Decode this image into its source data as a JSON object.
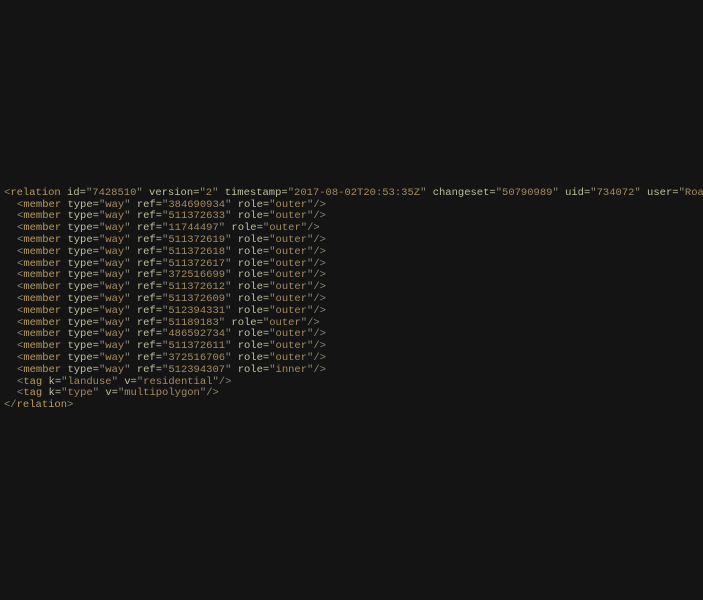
{
  "relation": {
    "id": "7428510",
    "version": "2",
    "timestamp": "2017-08-02T20:53:35Z",
    "changeset": "50790989",
    "uid": "734072",
    "user": "Roadsguy"
  },
  "members": [
    {
      "type": "way",
      "ref": "384690934",
      "role": "outer"
    },
    {
      "type": "way",
      "ref": "511372633",
      "role": "outer"
    },
    {
      "type": "way",
      "ref": "11744497",
      "role": "outer"
    },
    {
      "type": "way",
      "ref": "511372619",
      "role": "outer"
    },
    {
      "type": "way",
      "ref": "511372618",
      "role": "outer"
    },
    {
      "type": "way",
      "ref": "511372617",
      "role": "outer"
    },
    {
      "type": "way",
      "ref": "372516699",
      "role": "outer"
    },
    {
      "type": "way",
      "ref": "511372612",
      "role": "outer"
    },
    {
      "type": "way",
      "ref": "511372609",
      "role": "outer"
    },
    {
      "type": "way",
      "ref": "512394331",
      "role": "outer"
    },
    {
      "type": "way",
      "ref": "51189183",
      "role": "outer"
    },
    {
      "type": "way",
      "ref": "486592734",
      "role": "outer"
    },
    {
      "type": "way",
      "ref": "511372611",
      "role": "outer"
    },
    {
      "type": "way",
      "ref": "372516706",
      "role": "outer"
    },
    {
      "type": "way",
      "ref": "512394307",
      "role": "inner"
    }
  ],
  "tags": [
    {
      "k": "landuse",
      "v": "residential"
    },
    {
      "k": "type",
      "v": "multipolygon"
    }
  ],
  "labels": {
    "relation": "relation",
    "member": "member",
    "tag": "tag",
    "id": "id",
    "version": "version",
    "timestamp": "timestamp",
    "changeset": "changeset",
    "uid": "uid",
    "user": "user",
    "type": "type",
    "ref": "ref",
    "role": "role",
    "k": "k",
    "v": "v"
  }
}
